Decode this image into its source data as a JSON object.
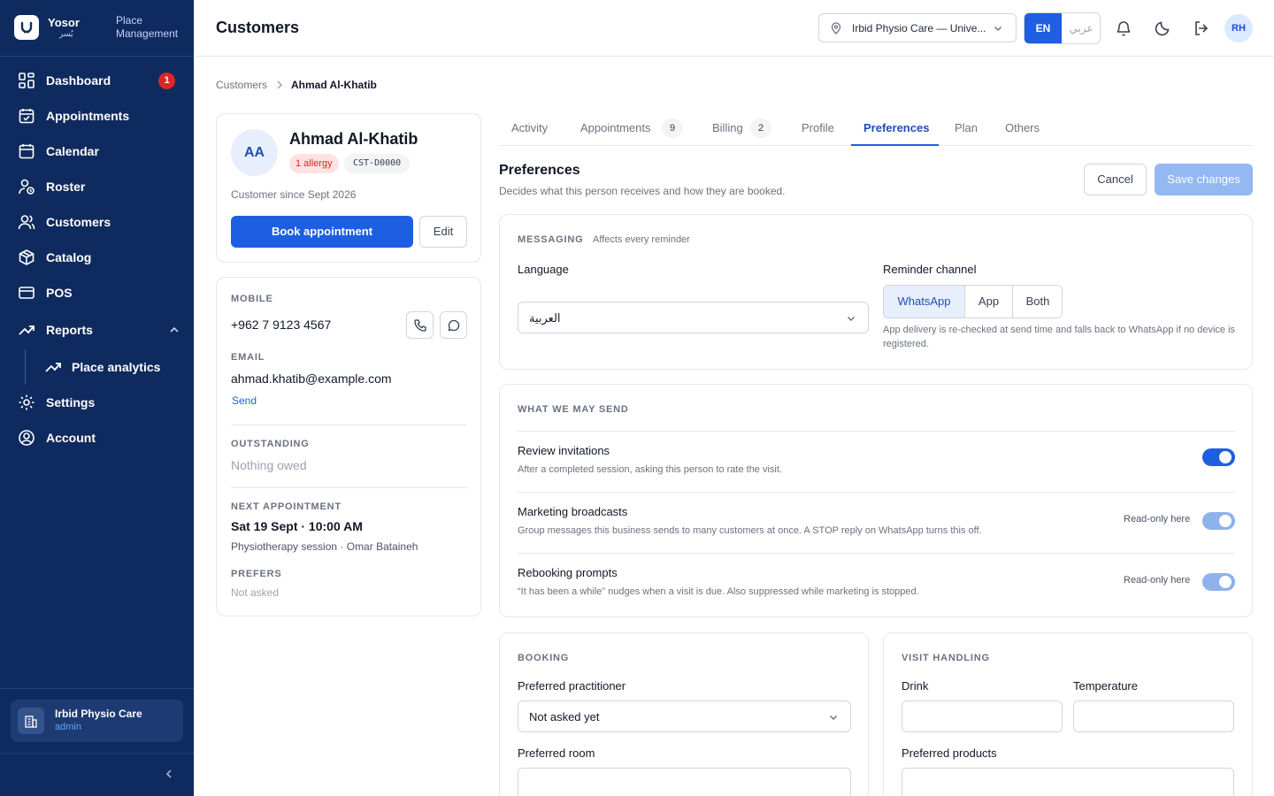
{
  "sidebar": {
    "brand": {
      "name": "Yosor",
      "name_ar": "يُسر",
      "tagline_1": "Place",
      "tagline_2": "Management"
    },
    "items": [
      {
        "label": "Dashboard",
        "badge": "1"
      },
      {
        "label": "Appointments"
      },
      {
        "label": "Calendar"
      },
      {
        "label": "Roster"
      },
      {
        "label": "Customers"
      },
      {
        "label": "Catalog"
      },
      {
        "label": "POS"
      },
      {
        "label": "Reports"
      },
      {
        "label": "Place analytics"
      },
      {
        "label": "Settings"
      },
      {
        "label": "Account"
      }
    ],
    "place": {
      "name": "Irbid Physio Care",
      "role": "admin"
    }
  },
  "header": {
    "title": "Customers",
    "location": "Irbid Physio Care — Unive...",
    "lang_en": "EN",
    "lang_ar": "عربي",
    "user_initials": "RH"
  },
  "breadcrumb": {
    "parent": "Customers",
    "current": "Ahmad Al-Khatib"
  },
  "customer": {
    "initials": "AA",
    "name": "Ahmad Al-Khatib",
    "allergy": "1 allergy",
    "code": "CST-D0000",
    "since": "Customer since Sept 2026",
    "book_label": "Book appointment",
    "edit_label": "Edit",
    "mobile_label": "MOBILE",
    "mobile": "+962 7 9123 4567",
    "email_label": "EMAIL",
    "email": "ahmad.khatib@example.com",
    "send_label": "Send",
    "outstanding_label": "OUTSTANDING",
    "outstanding": "Nothing owed",
    "next_label": "NEXT APPOINTMENT",
    "next_when": "Sat 19 Sept · 10:00 AM",
    "next_detail": "Physiotherapy session · Omar Bataineh",
    "prefers_label": "PREFERS",
    "prefers": "Not asked"
  },
  "tabs": [
    {
      "label": "Activity"
    },
    {
      "label": "Appointments",
      "count": "9"
    },
    {
      "label": "Billing",
      "count": "2"
    },
    {
      "label": "Profile"
    },
    {
      "label": "Preferences"
    },
    {
      "label": "Plan"
    },
    {
      "label": "Others"
    }
  ],
  "preferences": {
    "title": "Preferences",
    "subtitle": "Decides what this person receives and how they are booked.",
    "cancel": "Cancel",
    "save": "Save changes",
    "messaging": {
      "caption": "MESSAGING",
      "note": "Affects every reminder",
      "language_label": "Language",
      "language_value": "العربية",
      "channel_label": "Reminder channel",
      "channels": [
        "WhatsApp",
        "App",
        "Both"
      ],
      "selected_channel": "WhatsApp",
      "help": "App delivery is re-checked at send time and falls back to WhatsApp if no device is registered."
    },
    "send": {
      "caption": "WHAT WE MAY SEND",
      "rows": [
        {
          "title": "Review invitations",
          "desc": "After a completed session, asking this person to rate the visit.",
          "on": true
        },
        {
          "title": "Marketing broadcasts",
          "desc": "Group messages this business sends to many customers at once. A STOP reply on WhatsApp turns this off.",
          "readonly": "Read-only here",
          "on": true
        },
        {
          "title": "Rebooking prompts",
          "desc": "“It has been a while” nudges when a visit is due. Also suppressed while marketing is stopped.",
          "readonly": "Read-only here",
          "on": true
        }
      ]
    },
    "booking": {
      "caption": "BOOKING",
      "practitioner_label": "Preferred practitioner",
      "practitioner_value": "Not asked yet",
      "room_label": "Preferred room",
      "room_value": ""
    },
    "visit": {
      "caption": "VISIT HANDLING",
      "drink_label": "Drink",
      "drink_value": "",
      "temperature_label": "Temperature",
      "temperature_value": "",
      "products_label": "Preferred products",
      "products_value": ""
    }
  },
  "colors": {
    "sidebar": "#0f2a5e",
    "accent": "#1d5fe0",
    "danger": "#dc2626"
  }
}
